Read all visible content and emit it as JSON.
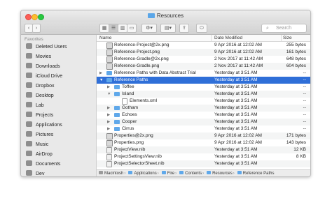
{
  "window": {
    "title": "Resources"
  },
  "toolbar": {
    "view_buttons": [
      "grid-view",
      "list-view",
      "column-view",
      "cover-flow-view"
    ],
    "search_placeholder": "Search"
  },
  "sidebar": {
    "heading": "Favorites",
    "items": [
      {
        "label": "Deleted Users",
        "icon": "folder-icon"
      },
      {
        "label": "Movies",
        "icon": "movies-icon"
      },
      {
        "label": "Downloads",
        "icon": "downloads-icon"
      },
      {
        "label": "iCloud Drive",
        "icon": "cloud-icon"
      },
      {
        "label": "Dropbox",
        "icon": "dropbox-icon"
      },
      {
        "label": "Desktop",
        "icon": "desktop-icon"
      },
      {
        "label": "Lab",
        "icon": "folder-icon"
      },
      {
        "label": "Projects",
        "icon": "folder-icon"
      },
      {
        "label": "Applications",
        "icon": "applications-icon"
      },
      {
        "label": "Pictures",
        "icon": "pictures-icon"
      },
      {
        "label": "Music",
        "icon": "music-icon"
      },
      {
        "label": "AirDrop",
        "icon": "airdrop-icon"
      },
      {
        "label": "Documents",
        "icon": "documents-icon"
      },
      {
        "label": "Dev",
        "icon": "folder-icon"
      }
    ]
  },
  "columns": {
    "name": "Name",
    "date": "Date Modified",
    "size": "Size"
  },
  "rows": [
    {
      "name": "Reference-Project@2x.png",
      "date": "9 Apr 2016 at 12:02 AM",
      "size": "255 bytes",
      "kind": "img",
      "indent": 0,
      "disclosure": ""
    },
    {
      "name": "Reference-Project.png",
      "date": "9 Apr 2016 at 12:02 AM",
      "size": "161 bytes",
      "kind": "img",
      "indent": 0,
      "disclosure": ""
    },
    {
      "name": "Reference-Gradle@2x.png",
      "date": "2 Nov 2017 at 11:42 AM",
      "size": "648 bytes",
      "kind": "img",
      "indent": 0,
      "disclosure": ""
    },
    {
      "name": "Reference-Gradle.png",
      "date": "2 Nov 2017 at 11:42 AM",
      "size": "604 bytes",
      "kind": "img",
      "indent": 0,
      "disclosure": ""
    },
    {
      "name": "Reference Paths with Data Abstract Trial",
      "date": "Yesterday at 3:51 AM",
      "size": "--",
      "kind": "folder",
      "indent": 0,
      "disclosure": "▶"
    },
    {
      "name": "Reference Paths",
      "date": "Yesterday at 3:51 AM",
      "size": "--",
      "kind": "folder",
      "indent": 0,
      "disclosure": "▼"
    },
    {
      "name": "Toffee",
      "date": "Yesterday at 3:51 AM",
      "size": "--",
      "kind": "folder",
      "indent": 1,
      "disclosure": "▶"
    },
    {
      "name": "Island",
      "date": "Yesterday at 3:51 AM",
      "size": "--",
      "kind": "folder",
      "indent": 1,
      "disclosure": "▼"
    },
    {
      "name": "Elements.xml",
      "date": "Yesterday at 3:51 AM",
      "size": "--",
      "kind": "file",
      "indent": 2,
      "disclosure": ""
    },
    {
      "name": "Gotham",
      "date": "Yesterday at 3:51 AM",
      "size": "--",
      "kind": "folder",
      "indent": 1,
      "disclosure": "▶"
    },
    {
      "name": "Echoes",
      "date": "Yesterday at 3:51 AM",
      "size": "--",
      "kind": "folder",
      "indent": 1,
      "disclosure": "▶"
    },
    {
      "name": "Cooper",
      "date": "Yesterday at 3:51 AM",
      "size": "--",
      "kind": "folder",
      "indent": 1,
      "disclosure": "▶"
    },
    {
      "name": "Cirrus",
      "date": "Yesterday at 3:51 AM",
      "size": "--",
      "kind": "folder",
      "indent": 1,
      "disclosure": "▶"
    },
    {
      "name": "Properties@2x.png",
      "date": "9 Apr 2016 at 12:02 AM",
      "size": "171 bytes",
      "kind": "img",
      "indent": 0,
      "disclosure": ""
    },
    {
      "name": "Properties.png",
      "date": "9 Apr 2016 at 12:02 AM",
      "size": "143 bytes",
      "kind": "img",
      "indent": 0,
      "disclosure": ""
    },
    {
      "name": "ProjectView.nib",
      "date": "Yesterday at 3:51 AM",
      "size": "12 KB",
      "kind": "nib",
      "indent": 0,
      "disclosure": ""
    },
    {
      "name": "ProjectSettingsView.nib",
      "date": "Yesterday at 3:51 AM",
      "size": "8 KB",
      "kind": "nib",
      "indent": 0,
      "disclosure": ""
    },
    {
      "name": "ProjectSelectorSheet.nib",
      "date": "Yesterday at 3:51 AM",
      "size": "",
      "kind": "nib",
      "indent": 0,
      "disclosure": ""
    }
  ],
  "selected_row": 5,
  "pathbar": [
    "Macintosh",
    "Applications",
    "Fire",
    "Contents",
    "Resources",
    "Reference Paths"
  ],
  "colors": {
    "selection": "#2f6fd8",
    "folder": "#5fa8ea"
  }
}
